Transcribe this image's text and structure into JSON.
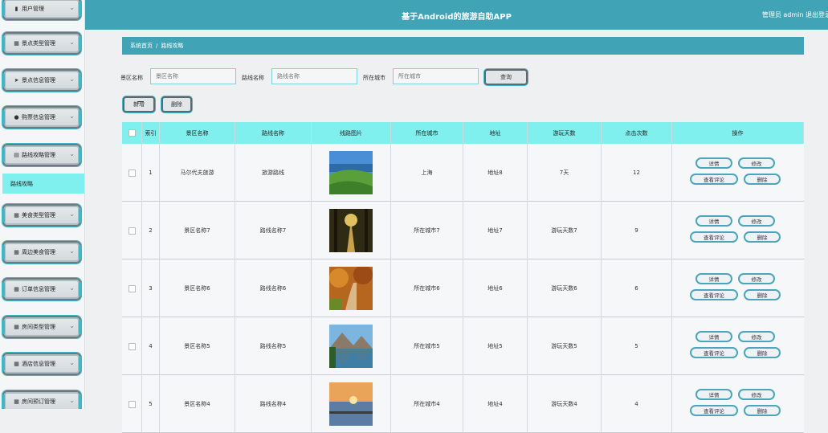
{
  "app": {
    "title": "基于Android的旅游自助APP",
    "user_label": "管理员 admin 退出登录"
  },
  "sidebar": {
    "items": [
      {
        "icon": "user-icon",
        "glyph": "▮",
        "label": "用户管理"
      },
      {
        "icon": "grid-icon",
        "glyph": "▦",
        "label": "景点类型管理"
      },
      {
        "icon": "send-icon",
        "glyph": "➤",
        "label": "景点信息管理"
      },
      {
        "icon": "person-icon",
        "glyph": "●",
        "label": "购票信息管理"
      },
      {
        "icon": "doc-icon",
        "glyph": "▤",
        "label": "路线攻略管理"
      },
      {
        "icon": "grid-icon",
        "glyph": "▦",
        "label": "美食类型管理"
      },
      {
        "icon": "grid-icon",
        "glyph": "▦",
        "label": "周边美食管理"
      },
      {
        "icon": "grid-icon",
        "glyph": "▦",
        "label": "订单信息管理"
      },
      {
        "icon": "grid-icon",
        "glyph": "▦",
        "label": "房间类型管理"
      },
      {
        "icon": "grid-icon",
        "glyph": "▦",
        "label": "酒店信息管理"
      },
      {
        "icon": "grid-icon",
        "glyph": "▦",
        "label": "房间预订管理"
      }
    ],
    "active_submenu": "路线攻略",
    "chevron": "⌄"
  },
  "breadcrumb": {
    "home": "系统首页",
    "separator": "/",
    "current": "路线攻略"
  },
  "search": {
    "fields": [
      {
        "label": "景区名称",
        "placeholder": "景区名称",
        "value": ""
      },
      {
        "label": "路线名称",
        "placeholder": "路线名称",
        "value": ""
      },
      {
        "label": "所在城市",
        "placeholder": "所在城市",
        "value": ""
      }
    ],
    "query_label": "查询"
  },
  "actions": {
    "add_label": "新增",
    "delete_label": "删除"
  },
  "table": {
    "columns": [
      "",
      "索引",
      "景区名称",
      "路线名称",
      "线路图片",
      "所在城市",
      "地址",
      "游玩天数",
      "点击次数",
      "操作"
    ],
    "rows": [
      {
        "index": "1",
        "scenic": "马尔代夫旅游",
        "route": "旅游路线",
        "image": "green-hills",
        "city": "上海",
        "address": "地址8",
        "days": "7天",
        "clicks": "12"
      },
      {
        "index": "2",
        "scenic": "景区名称7",
        "route": "路线名称7",
        "image": "forest-path",
        "city": "所在城市7",
        "address": "地址7",
        "days": "游玩天数7",
        "clicks": "9"
      },
      {
        "index": "3",
        "scenic": "景区名称6",
        "route": "路线名称6",
        "image": "autumn-path",
        "city": "所在城市6",
        "address": "地址6",
        "days": "游玩天数6",
        "clicks": "6"
      },
      {
        "index": "4",
        "scenic": "景区名称5",
        "route": "路线名称5",
        "image": "mountain-lake",
        "city": "所在城市5",
        "address": "地址5",
        "days": "游玩天数5",
        "clicks": "5"
      },
      {
        "index": "5",
        "scenic": "景区名称4",
        "route": "路线名称4",
        "image": "sunset-pier",
        "city": "所在城市4",
        "address": "地址4",
        "days": "游玩天数4",
        "clicks": "4"
      }
    ],
    "row_actions": {
      "detail": "详情",
      "edit": "修改",
      "comments": "查看评论",
      "delete": "删除"
    }
  },
  "colors": {
    "header": "#41a3b6",
    "table_header": "#7ff0ee",
    "accent": "#3fb7c7"
  }
}
